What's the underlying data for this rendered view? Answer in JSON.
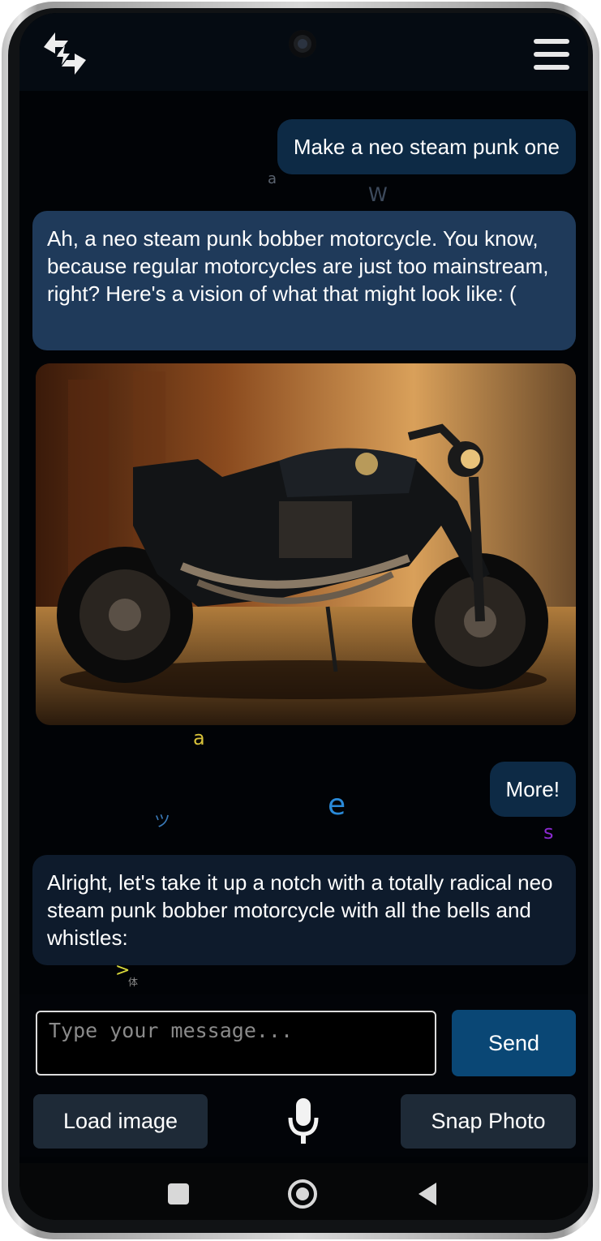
{
  "header": {
    "logo_icon": "lightning-swap-icon",
    "menu_icon": "hamburger-menu-icon"
  },
  "messages": [
    {
      "role": "user",
      "text": "Make a neo steam punk one"
    },
    {
      "role": "assistant",
      "text": "Ah, a neo steam punk bobber motorcycle. You know, because regular motorcycles are just too mainstream, right? Here's a vision of what that might look like: ("
    },
    {
      "role": "assistant_image",
      "subject": "motorcycle"
    },
    {
      "role": "user",
      "text": "More!"
    },
    {
      "role": "assistant",
      "text": "Alright, let's take it up a notch with a totally radical neo steam punk bobber motorcycle with all the bells and whistles:"
    }
  ],
  "floating_chars": [
    "a",
    "W",
    "a",
    "ツ",
    "e",
    "s",
    ">",
    "体"
  ],
  "composer": {
    "placeholder": "Type your message...",
    "send_label": "Send",
    "load_image_label": "Load image",
    "snap_photo_label": "Snap Photo",
    "mic_icon": "microphone-icon"
  },
  "system_nav": {
    "recents_icon": "square-recents-icon",
    "home_icon": "circle-home-icon",
    "back_icon": "triangle-back-icon"
  },
  "colors": {
    "user_bubble": "#0d2a45",
    "assistant_bubble_1": "#1f3a5a",
    "assistant_bubble_2": "#0e1b2c",
    "send_button": "#0a4775",
    "action_button": "#1e2a37"
  }
}
